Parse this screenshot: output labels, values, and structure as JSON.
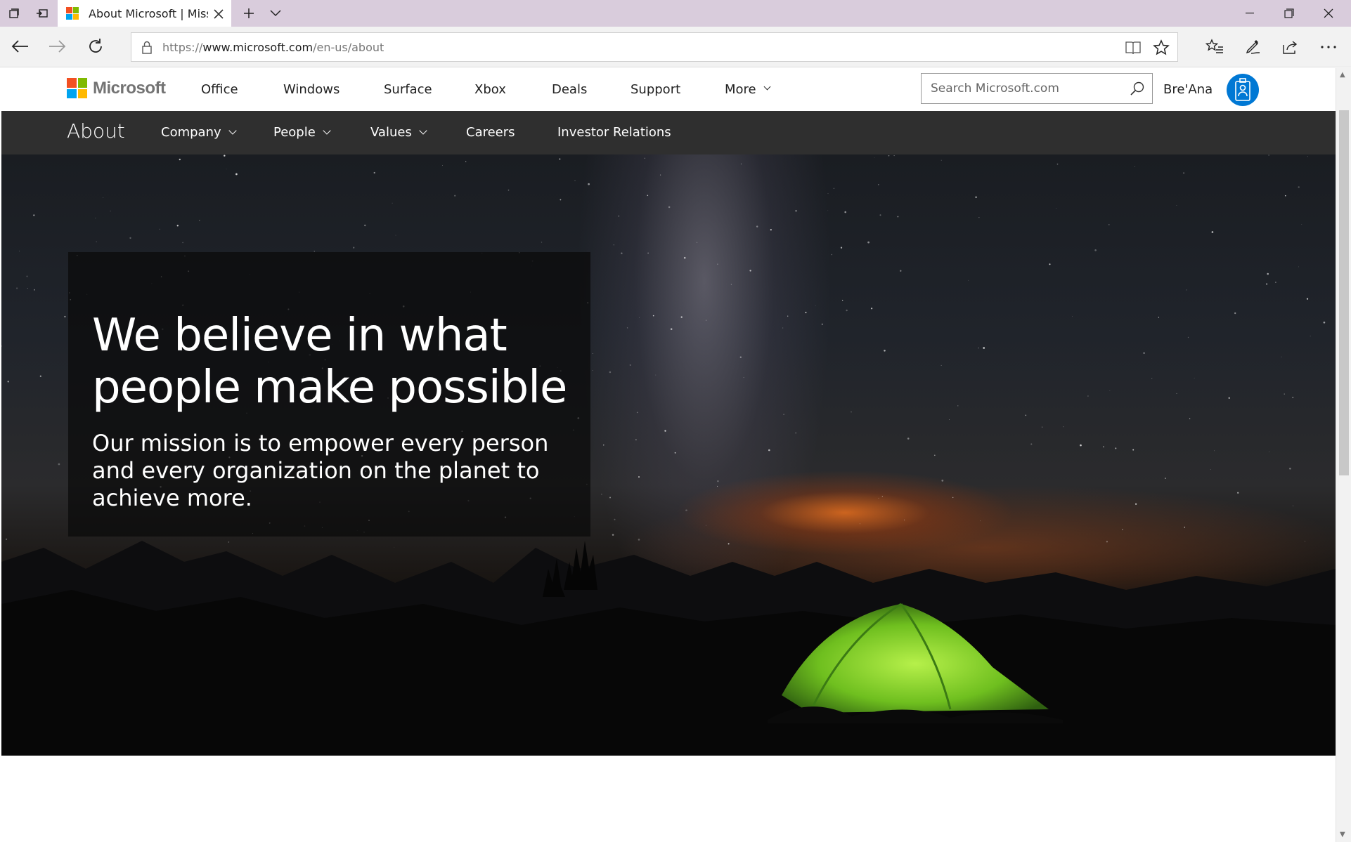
{
  "browser": {
    "tab_title": "About Microsoft | Mission and Vision",
    "url_prefix": "https://",
    "url_domain": "www.microsoft.com",
    "url_path": "/en-us/about"
  },
  "header": {
    "logo_text": "Microsoft",
    "nav": [
      "Office",
      "Windows",
      "Surface",
      "Xbox",
      "Deals",
      "Support",
      "More"
    ],
    "search_placeholder": "Search Microsoft.com",
    "user_name": "Bre'Ana"
  },
  "subnav": {
    "brand": "About",
    "items": [
      "Company",
      "People",
      "Values",
      "Careers",
      "Investor Relations"
    ]
  },
  "hero": {
    "headline": "We believe in what people make possible",
    "mission": "Our mission is to empower every person and every organization on the planet to achieve more."
  },
  "colors": {
    "ms_red": "#f25022",
    "ms_green": "#7fba00",
    "ms_blue": "#00a4ef",
    "ms_yellow": "#ffb900",
    "subnav_bg": "#2f2f2f",
    "avatar_bg": "#0078d4",
    "tent_green": "#7ed321"
  }
}
